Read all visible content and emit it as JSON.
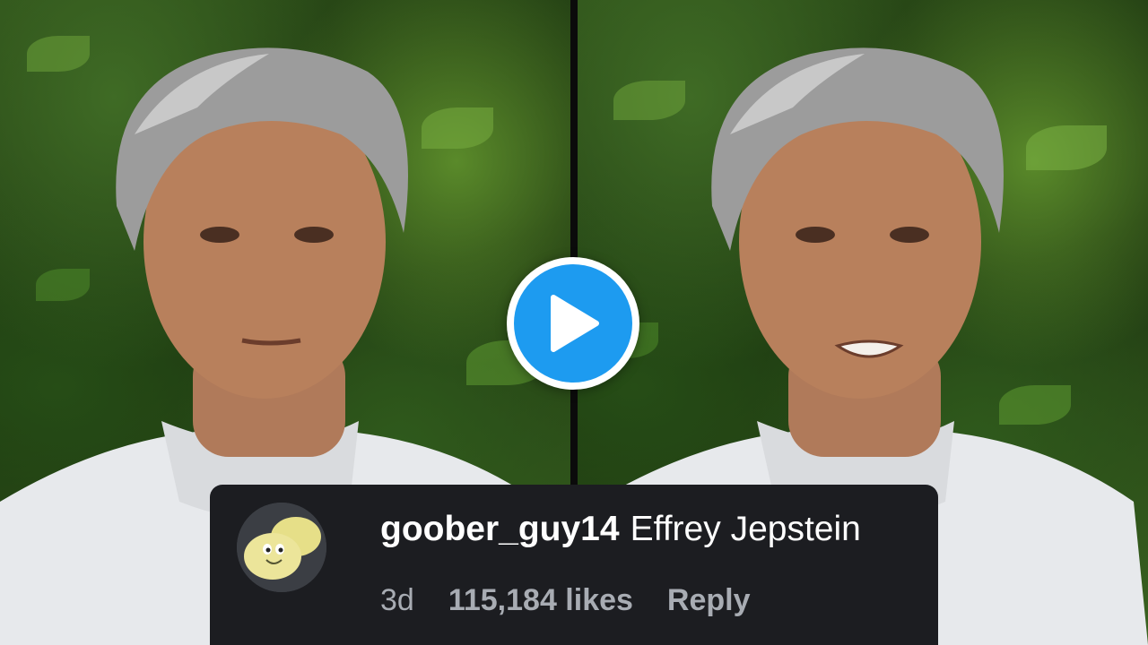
{
  "video": {
    "play_icon": "play-icon",
    "accent_color": "#1d9bf0"
  },
  "comment": {
    "avatar_icon": "smiling-eggs-avatar",
    "username": "goober_guy14",
    "text": "Effrey Jepstein",
    "time_ago": "3d",
    "likes": "115,184 likes",
    "reply_label": "Reply",
    "background_color": "#1c1d21"
  }
}
